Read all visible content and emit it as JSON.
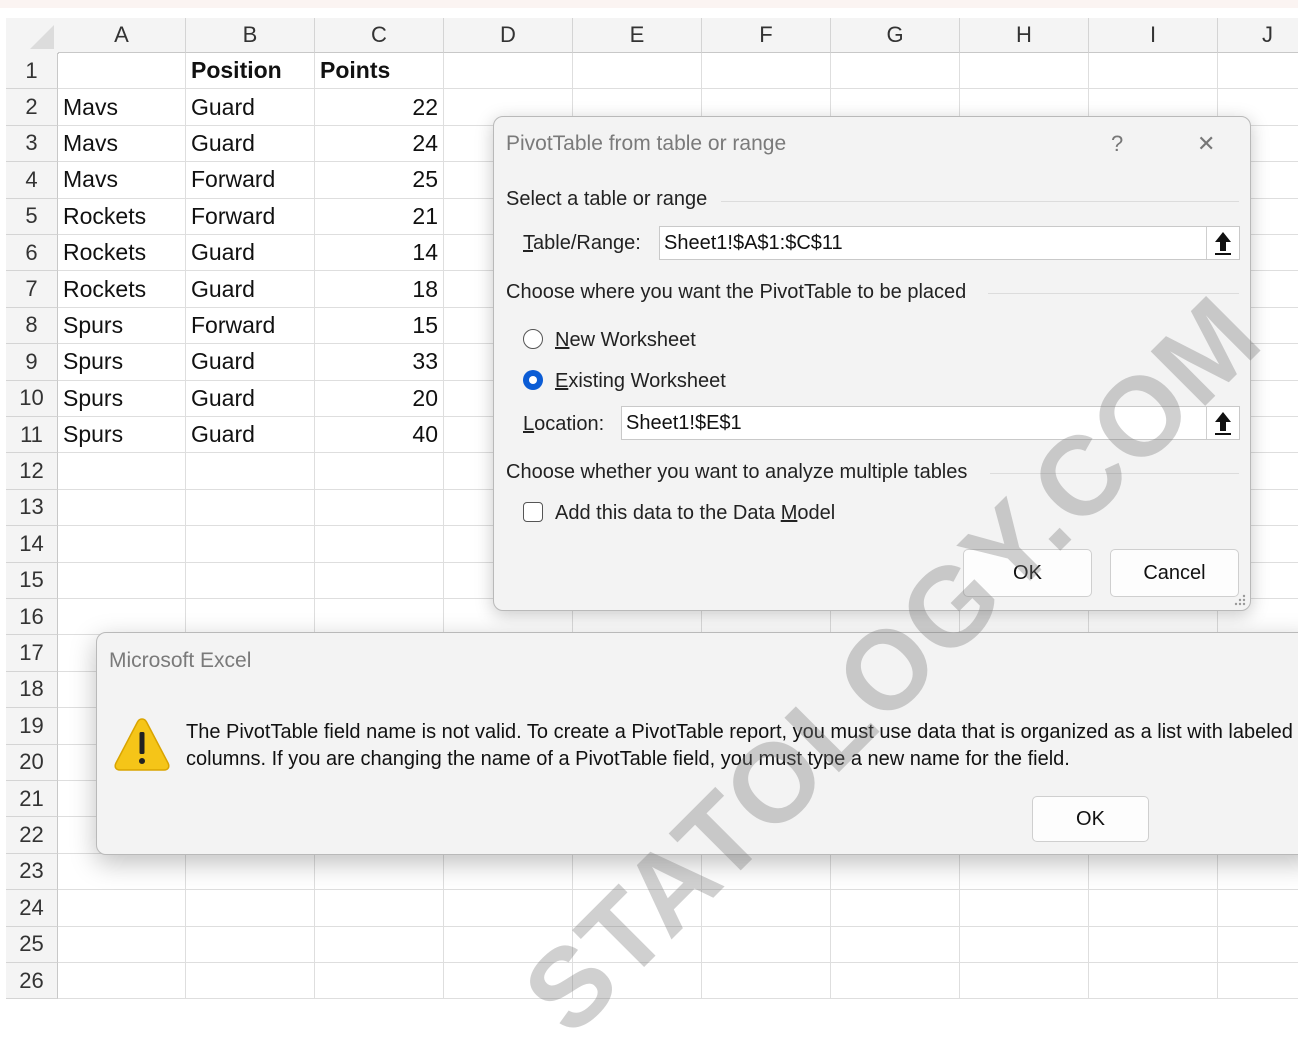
{
  "sheet": {
    "columns": [
      "A",
      "B",
      "C",
      "D",
      "E",
      "F",
      "G",
      "H",
      "I",
      "J"
    ],
    "rows": [
      "1",
      "2",
      "3",
      "4",
      "5",
      "6",
      "7",
      "8",
      "9",
      "10",
      "11",
      "12",
      "13",
      "14",
      "15",
      "16",
      "17",
      "18",
      "19",
      "20",
      "21",
      "22",
      "23",
      "24",
      "25",
      "26"
    ],
    "header_row": [
      "",
      "Position",
      "Points"
    ],
    "data": [
      [
        "Mavs",
        "Guard",
        "22"
      ],
      [
        "Mavs",
        "Guard",
        "24"
      ],
      [
        "Mavs",
        "Forward",
        "25"
      ],
      [
        "Rockets",
        "Forward",
        "21"
      ],
      [
        "Rockets",
        "Guard",
        "14"
      ],
      [
        "Rockets",
        "Guard",
        "18"
      ],
      [
        "Spurs",
        "Forward",
        "15"
      ],
      [
        "Spurs",
        "Guard",
        "33"
      ],
      [
        "Spurs",
        "Guard",
        "20"
      ],
      [
        "Spurs",
        "Guard",
        "40"
      ]
    ]
  },
  "pivot_dialog": {
    "title": "PivotTable from table or range",
    "help": "?",
    "close": "✕",
    "section_select": "Select a table or range",
    "range_label_key": "T",
    "range_label_rest": "able/Range:",
    "range_value": "Sheet1!$A$1:$C$11",
    "section_place": "Choose where you want the PivotTable to be placed",
    "option_new_key": "N",
    "option_new_rest": "ew Worksheet",
    "option_existing_key": "E",
    "option_existing_rest": "xisting Worksheet",
    "location_label_key": "L",
    "location_label_rest": "ocation:",
    "location_value": "Sheet1!$E$1",
    "section_multi": "Choose whether you want to analyze multiple tables",
    "data_model_pre": "Add this data to the Data ",
    "data_model_key": "M",
    "data_model_post": "odel",
    "ok": "OK",
    "cancel": "Cancel"
  },
  "excel_message": {
    "title": "Microsoft Excel",
    "text": "The PivotTable field name is not valid. To create a PivotTable report, you must use data that is organized as a list with labeled columns. If you are changing the name of a PivotTable field, you must type a new name for the field.",
    "ok": "OK"
  },
  "watermark": "STATOLOGY.COM",
  "colors": {
    "accent": "#0b5cd5",
    "warning": "#f5c518"
  }
}
